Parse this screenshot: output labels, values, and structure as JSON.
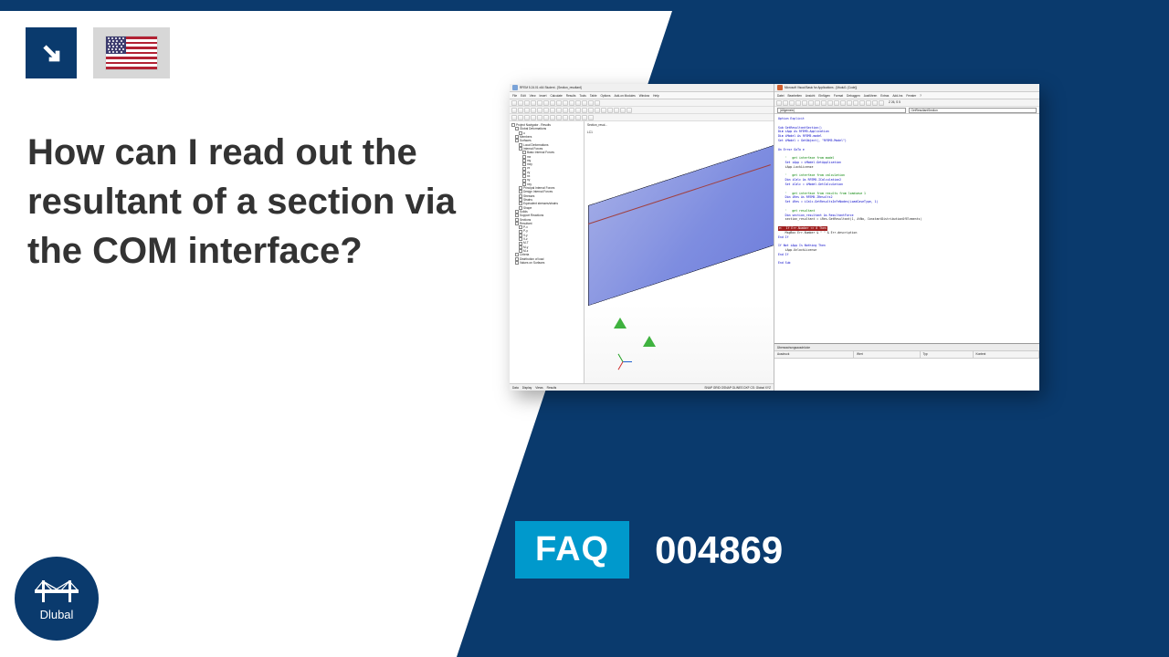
{
  "header": {
    "arrow_name": "arrow-down-right",
    "flag_country": "United States"
  },
  "question": "How can I read out the resultant of a section via the COM interface?",
  "faq": {
    "label": "FAQ",
    "number": "004869"
  },
  "brand": "Dlubal",
  "screenshot": {
    "rfem": {
      "title": "RFEM 5.24.01 x64 Student - [Section_resultant]",
      "menu": [
        "File",
        "Edit",
        "View",
        "Insert",
        "Calculate",
        "Results",
        "Tools",
        "Table",
        "Options",
        "Add-on Modules",
        "Window",
        "Help"
      ],
      "toolbars": [
        [
          "new",
          "open",
          "save",
          "print",
          "undo",
          "redo",
          "copy",
          "paste",
          "sel",
          "find",
          "grid",
          "snap",
          "layer",
          "view"
        ],
        [
          "iso",
          "top",
          "front",
          "side",
          "zoomf",
          "zoomw",
          "zoomr",
          "pan",
          "rot",
          "render",
          "wire",
          "shade",
          "mesh",
          "axes",
          "num",
          "load",
          "res",
          "anim",
          "meas"
        ],
        [
          "lc-sel",
          "LC1",
          "<",
          ">",
          "play",
          "opts",
          "show",
          "hide",
          "filter",
          "colors",
          "scale",
          "label",
          "help"
        ]
      ],
      "tree": [
        {
          "l": 0,
          "t": "Project Navigator - Results"
        },
        {
          "l": 1,
          "t": "Global Deformations"
        },
        {
          "l": 2,
          "t": "u"
        },
        {
          "l": 1,
          "t": "Members"
        },
        {
          "l": 1,
          "t": "Surfaces"
        },
        {
          "l": 2,
          "t": "Local Deformations"
        },
        {
          "l": 2,
          "t": "Internal Forces"
        },
        {
          "l": 3,
          "t": "Basic Internal Forces"
        },
        {
          "l": 3,
          "t": "mx"
        },
        {
          "l": 3,
          "t": "my"
        },
        {
          "l": 3,
          "t": "mxy"
        },
        {
          "l": 3,
          "t": "vx"
        },
        {
          "l": 3,
          "t": "vy"
        },
        {
          "l": 3,
          "t": "nx"
        },
        {
          "l": 3,
          "t": "ny"
        },
        {
          "l": 3,
          "t": "nxy"
        },
        {
          "l": 2,
          "t": "Principal Internal Forces"
        },
        {
          "l": 2,
          "t": "Design Internal Forces"
        },
        {
          "l": 2,
          "t": "Stresses"
        },
        {
          "l": 2,
          "t": "Strains"
        },
        {
          "l": 2,
          "t": "Equivalent stresses/strains"
        },
        {
          "l": 2,
          "t": "Shape"
        },
        {
          "l": 1,
          "t": "Solids"
        },
        {
          "l": 1,
          "t": "Support Reactions"
        },
        {
          "l": 1,
          "t": "Sections"
        },
        {
          "l": 1,
          "t": "Resultant"
        },
        {
          "l": 2,
          "t": "P-x"
        },
        {
          "l": 2,
          "t": "P-y"
        },
        {
          "l": 2,
          "t": "V-y"
        },
        {
          "l": 2,
          "t": "V-z"
        },
        {
          "l": 2,
          "t": "M-T"
        },
        {
          "l": 2,
          "t": "M-y"
        },
        {
          "l": 2,
          "t": "M-z"
        },
        {
          "l": 1,
          "t": "Criteria"
        },
        {
          "l": 1,
          "t": "Distribution of load"
        },
        {
          "l": 1,
          "t": "Values on Surfaces"
        }
      ],
      "viewport_label": "Section_resul...",
      "lc_label": "LC1",
      "status_tabs": [
        "Data",
        "Display",
        "Views",
        "Results"
      ],
      "status_right": "SNAP  GRID  OSNAP  GLINES  DXF  CS: Global XYZ"
    },
    "vba": {
      "title": "Microsoft Visual Basic for Applications - [Modul1 (Code)]",
      "menu": [
        "Datei",
        "Bearbeiten",
        "Ansicht",
        "Einfügen",
        "Format",
        "Debuggen",
        "Ausführen",
        "Extras",
        "Add-Ins",
        "Fenster",
        "?"
      ],
      "toolbar": [
        "view",
        "save",
        "cut",
        "copy",
        "paste",
        "find",
        "undo",
        "redo",
        "run",
        "break",
        "reset",
        "design",
        "step",
        "proj",
        "props",
        "obj",
        "help"
      ],
      "toolbar_caret": "Z 26, S 5",
      "combo_left": "(Allgemein)",
      "combo_right": "GetResultantSection",
      "code_lines": [
        {
          "c": "kw",
          "t": "Option Explicit"
        },
        {
          "c": "",
          "t": ""
        },
        {
          "c": "kw",
          "t": "Sub GetResultantSection()"
        },
        {
          "c": "kw",
          "t": "Dim iApp As RFEM5.Application"
        },
        {
          "c": "kw",
          "t": "Dim iModel As RFEM5.model"
        },
        {
          "c": "kw",
          "t": "Set iModel = GetObject(, \"RFEM5.Model\")"
        },
        {
          "c": "",
          "t": ""
        },
        {
          "c": "kw",
          "t": "On Error GoTo e"
        },
        {
          "c": "",
          "t": ""
        },
        {
          "c": "cm",
          "t": "    '   get interface from model"
        },
        {
          "c": "kw",
          "t": "    Set iApp = iModel.GetApplication"
        },
        {
          "c": "",
          "t": "    iApp.LockLicense"
        },
        {
          "c": "",
          "t": ""
        },
        {
          "c": "cm",
          "t": "    '   get interface from calculation"
        },
        {
          "c": "kw",
          "t": "    Dim iCalc As RFEM5.ICalculation2"
        },
        {
          "c": "kw",
          "t": "    Set iCalc = iModel.GetCalculation"
        },
        {
          "c": "",
          "t": ""
        },
        {
          "c": "cm",
          "t": "    '   get interface from results from loadcase 1"
        },
        {
          "c": "kw",
          "t": "    Dim iRes As RFEM5.IResults2"
        },
        {
          "c": "kw",
          "t": "    Set iRes = iCalc.GetResultsInFeNodes(LoadCaseType, 1)"
        },
        {
          "c": "",
          "t": ""
        },
        {
          "c": "cm",
          "t": "    '   get resultant"
        },
        {
          "c": "kw",
          "t": "    Dim section_resultant As ResultantForce"
        },
        {
          "c": "",
          "t": "    section_resultant = iRes.GetResultant(1, AtNo, ConstantDistributionOfElements)"
        },
        {
          "c": "",
          "t": ""
        },
        {
          "c": "hl",
          "t": "e:  If Err.Number <> 0 Then"
        },
        {
          "c": "",
          "t": "    MsgBox Err.Number & \" \" & Err.description"
        },
        {
          "c": "kw",
          "t": "End If"
        },
        {
          "c": "",
          "t": ""
        },
        {
          "c": "kw",
          "t": "If Not iApp Is Nothing Then"
        },
        {
          "c": "",
          "t": "    iApp.UnlockLicense"
        },
        {
          "c": "kw",
          "t": "End If"
        },
        {
          "c": "",
          "t": ""
        },
        {
          "c": "kw",
          "t": "End Sub"
        }
      ],
      "watch_title": "Überwachungsausdrücke",
      "watch_cols": [
        "Ausdruck",
        "Wert",
        "Typ",
        "Kontext"
      ]
    }
  }
}
